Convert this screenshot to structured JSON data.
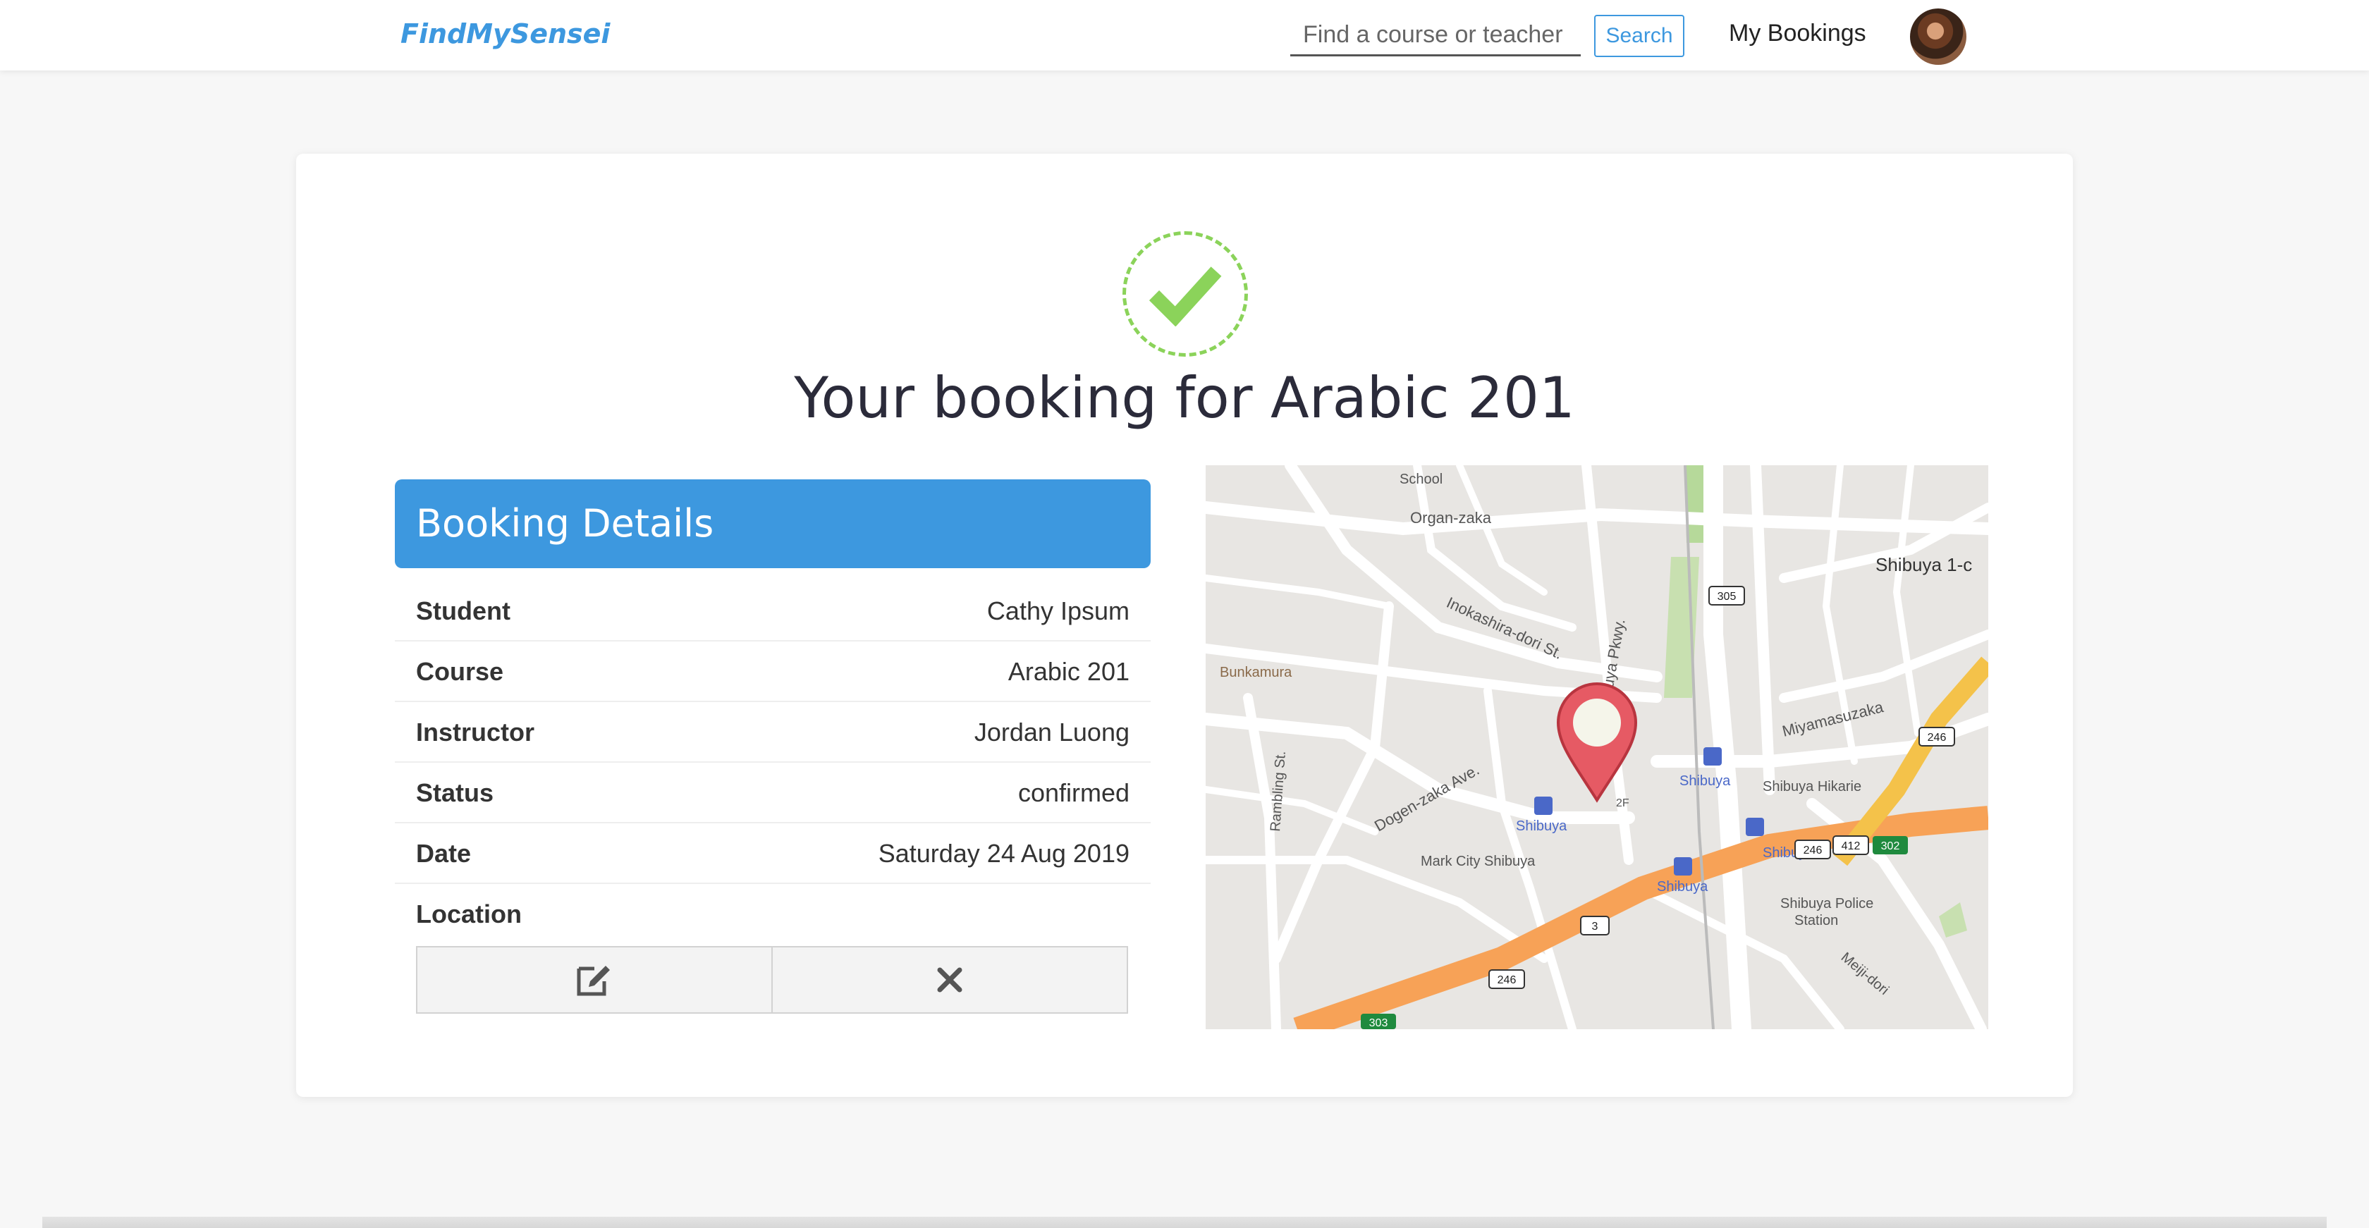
{
  "navbar": {
    "brand": "FindMySensei",
    "search_placeholder": "Find a course or teacher",
    "search_button": "Search",
    "my_bookings": "My Bookings"
  },
  "page": {
    "title": "Your booking for Arabic 201"
  },
  "details": {
    "header": "Booking Details",
    "rows": [
      {
        "label": "Student",
        "value": "Cathy Ipsum"
      },
      {
        "label": "Course",
        "value": "Arabic 201"
      },
      {
        "label": "Instructor",
        "value": "Jordan Luong"
      },
      {
        "label": "Status",
        "value": "confirmed"
      },
      {
        "label": "Date",
        "value": "Saturday 24 Aug 2019"
      },
      {
        "label": "Location",
        "value": ""
      }
    ],
    "actions": [
      {
        "name": "edit",
        "icon": "edit-icon"
      },
      {
        "name": "cancel",
        "icon": "close-icon"
      }
    ]
  },
  "map": {
    "labels": [
      "School",
      "Organ-zaka",
      "Shibuya 1-c",
      "Inokashira-dori St.",
      "Bunkamura",
      "Shibuya Pkwy.",
      "Miyamasuzaka",
      "Shibuya",
      "Shibuya Hikarie",
      "Dogen-zaka Ave.",
      "Rambling St.",
      "Shibuya",
      "Mark City Shibuya",
      "Shibuya",
      "Shibuya",
      "Shibuya Police",
      "Station",
      "Meiji-dori",
      "2F"
    ],
    "route_numbers": [
      "305",
      "246",
      "246",
      "412",
      "302",
      "3",
      "246",
      "303"
    ],
    "marker_color": "#e65a64"
  },
  "colors": {
    "brand": "#3d98df",
    "success": "#8bd35a"
  }
}
